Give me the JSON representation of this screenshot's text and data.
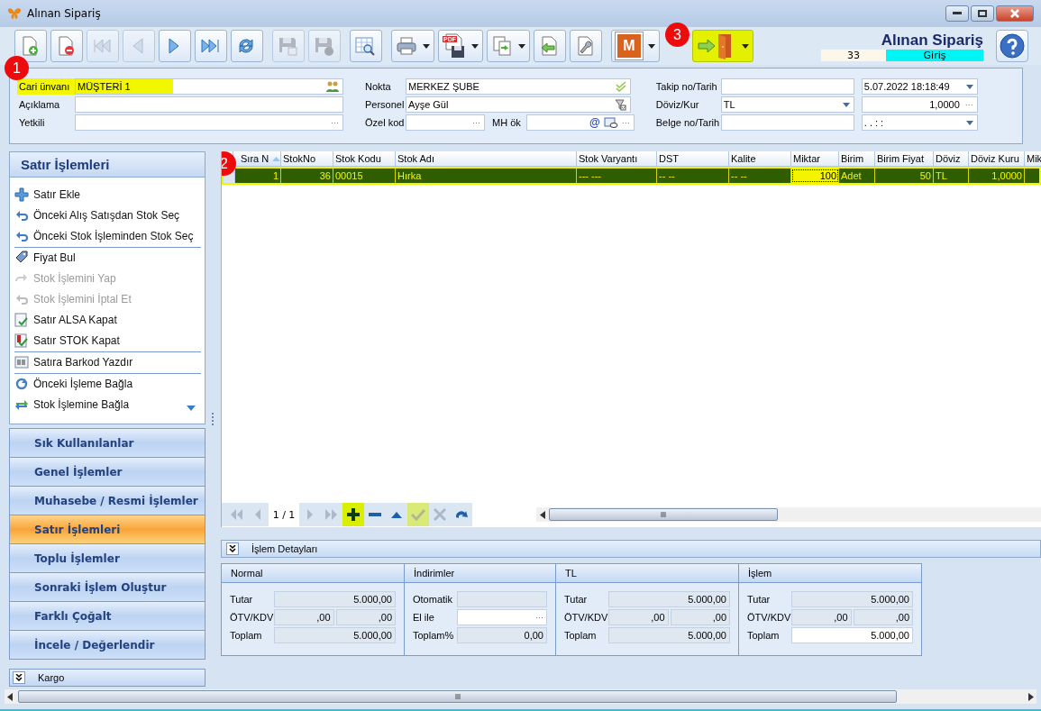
{
  "window": {
    "title": "Alınan Sipariş"
  },
  "toolbar": {
    "buttons": [
      {
        "kind": "new",
        "disabled": false,
        "dropdown": false,
        "highlighted": false
      },
      {
        "kind": "delete",
        "disabled": false,
        "dropdown": false,
        "highlighted": false
      },
      {
        "kind": "first",
        "disabled": true,
        "dropdown": false,
        "highlighted": false
      },
      {
        "kind": "prev",
        "disabled": true,
        "dropdown": false,
        "highlighted": false
      },
      {
        "kind": "next",
        "disabled": false,
        "dropdown": false,
        "highlighted": false
      },
      {
        "kind": "last",
        "disabled": false,
        "dropdown": false,
        "highlighted": false
      },
      {
        "kind": "refresh",
        "disabled": false,
        "dropdown": false,
        "highlighted": false
      },
      {
        "kind": "save",
        "disabled": true,
        "dropdown": false,
        "highlighted": false
      },
      {
        "kind": "save-close",
        "disabled": true,
        "dropdown": false,
        "highlighted": false
      },
      {
        "kind": "grid-search",
        "disabled": false,
        "dropdown": false,
        "highlighted": false
      },
      {
        "kind": "print",
        "disabled": false,
        "dropdown": true,
        "highlighted": false
      },
      {
        "kind": "pdf",
        "disabled": false,
        "dropdown": true,
        "highlighted": false,
        "label": "PDF"
      },
      {
        "kind": "copy",
        "disabled": false,
        "dropdown": true,
        "highlighted": false
      },
      {
        "kind": "import",
        "disabled": false,
        "dropdown": false,
        "highlighted": false
      },
      {
        "kind": "tools",
        "disabled": false,
        "dropdown": false,
        "highlighted": false
      },
      {
        "kind": "m",
        "disabled": false,
        "dropdown": true,
        "highlighted": false,
        "label": "M"
      },
      {
        "kind": "exit",
        "disabled": false,
        "dropdown": true,
        "highlighted": true,
        "marker": "3"
      }
    ],
    "heading": "Alınan Sipariş",
    "number": "33",
    "status": "Giriş"
  },
  "form": {
    "marker": "1",
    "columns": [
      [
        {
          "label": "Cari ünvanı",
          "highlighted": true,
          "inputs": [
            {
              "kind": "textbox",
              "value": "MÜŞTERİ 1",
              "adornments": [
                {
                  "kind": "people"
                }
              ]
            }
          ]
        },
        {
          "label": "Açıklama",
          "highlighted": false,
          "inputs": [
            {
              "kind": "textbox"
            }
          ]
        },
        {
          "label": "Yetkili",
          "highlighted": false,
          "inputs": [
            {
              "kind": "textbox",
              "adornments": [
                {
                  "kind": "glyph",
                  "text": "···"
                }
              ]
            }
          ]
        }
      ],
      [
        {
          "label": "Nokta",
          "highlighted": false,
          "inputs": [
            {
              "kind": "textbox",
              "value": "MERKEZ ŞUBE",
              "adornments": [
                {
                  "kind": "check"
                }
              ]
            }
          ]
        },
        {
          "label": "Personel",
          "highlighted": false,
          "inputs": [
            {
              "kind": "textbox",
              "value": "Ayşe Gül",
              "adornments": [
                {
                  "kind": "filter"
                }
              ]
            }
          ]
        },
        {
          "label": "Özel kod",
          "highlighted": false,
          "inputs": [
            {
              "kind": "textbox",
              "adornments": [
                {
                  "kind": "glyph",
                  "text": "···"
                }
              ]
            },
            {
              "kind": "textbox",
              "label": "MH ök",
              "adornments": [
                {
                  "kind": "glyph",
                  "text": "@"
                },
                {
                  "kind": "card"
                },
                {
                  "kind": "glyph",
                  "text": "···"
                }
              ]
            }
          ]
        }
      ],
      [
        {
          "label": "Takip no/Tarih",
          "highlighted": false,
          "inputs": [
            {
              "kind": "textbox"
            },
            {
              "kind": "combo",
              "value": "5.07.2022 18:18:49"
            }
          ]
        },
        {
          "label": "Döviz/Kur",
          "highlighted": false,
          "inputs": [
            {
              "kind": "combo",
              "value": "TL"
            },
            {
              "kind": "number",
              "value": "1,0000",
              "adornments": [
                {
                  "kind": "glyph",
                  "text": "···"
                }
              ]
            }
          ]
        },
        {
          "label": "Belge no/Tarih",
          "highlighted": false,
          "inputs": [
            {
              "kind": "textbox"
            },
            {
              "kind": "combo",
              "value": ". .     : :"
            }
          ]
        }
      ]
    ]
  },
  "side_panel": {
    "title": "Satır İşlemleri",
    "items": [
      {
        "kind": "plus",
        "label": "Satır Ekle",
        "disabled": false,
        "divider_after": false
      },
      {
        "kind": "back",
        "label": "Önceki Alış Satışdan Stok Seç",
        "disabled": false,
        "divider_after": false
      },
      {
        "kind": "back",
        "label": "Önceki Stok İşleminden Stok Seç",
        "disabled": false,
        "divider_after": true
      },
      {
        "kind": "tag",
        "label": "Fiyat Bul",
        "disabled": false,
        "divider_after": false
      },
      {
        "kind": "redo",
        "label": "Stok İşlemini Yap",
        "disabled": true,
        "divider_after": false
      },
      {
        "kind": "undo",
        "label": "Stok İşlemini İptal Et",
        "disabled": true,
        "divider_after": false
      },
      {
        "kind": "doc-check",
        "label": "Satır ALSA Kapat",
        "disabled": false,
        "divider_after": false
      },
      {
        "kind": "doc-flag-check",
        "label": "Satır STOK Kapat",
        "disabled": false,
        "divider_after": true
      },
      {
        "kind": "barcode",
        "label": "Satıra Barkod Yazdır",
        "disabled": false,
        "divider_after": true
      },
      {
        "kind": "cycle",
        "label": "Önceki İşleme Bağla",
        "disabled": false,
        "divider_after": false
      },
      {
        "kind": "swap",
        "label": "Stok İşlemine Bağla",
        "disabled": false,
        "divider_after": false
      }
    ],
    "groups": [
      {
        "label": "Sık Kullanılanlar",
        "selected": false
      },
      {
        "label": "Genel İşlemler",
        "selected": false
      },
      {
        "label": "Muhasebe / Resmi İşlemler",
        "selected": false
      },
      {
        "label": "Satır İşlemleri",
        "selected": true
      },
      {
        "label": "Toplu İşlemler",
        "selected": false
      },
      {
        "label": "Sonraki İşlem Oluştur",
        "selected": false
      },
      {
        "label": "Farklı Çoğalt",
        "selected": false
      },
      {
        "label": "İncele / Değerlendir",
        "selected": false
      }
    ],
    "footer": "Kargo"
  },
  "grid": {
    "marker": "2",
    "columns": [
      {
        "label": "Sıra N",
        "kind": "number",
        "sorted": true
      },
      {
        "label": "StokNo",
        "kind": "number",
        "sorted": false
      },
      {
        "label": "Stok Kodu",
        "kind": "text",
        "sorted": false
      },
      {
        "label": "Stok Adı",
        "kind": "text",
        "sorted": false
      },
      {
        "label": "Stok Varyantı",
        "kind": "text",
        "sorted": false
      },
      {
        "label": "DST",
        "kind": "text",
        "sorted": false
      },
      {
        "label": "Kalite",
        "kind": "text",
        "sorted": false
      },
      {
        "label": "Miktar",
        "kind": "number",
        "sorted": false
      },
      {
        "label": "Birim",
        "kind": "text",
        "sorted": false
      },
      {
        "label": "Birim Fiyat",
        "kind": "number",
        "sorted": false
      },
      {
        "label": "Döviz",
        "kind": "text",
        "sorted": false
      },
      {
        "label": "Döviz Kuru",
        "kind": "number",
        "sorted": false
      },
      {
        "label": "Mik",
        "kind": "text",
        "sorted": false
      }
    ],
    "rows": [
      {
        "selected": true,
        "cells": [
          {
            "text": "1",
            "focused": false
          },
          {
            "text": "36",
            "focused": false
          },
          {
            "text": "00015",
            "focused": false
          },
          {
            "text": "Hırka",
            "focused": false
          },
          {
            "text": "--- ---",
            "focused": false
          },
          {
            "text": "-- --",
            "focused": false
          },
          {
            "text": "-- --",
            "focused": false
          },
          {
            "text": "100",
            "focused": true
          },
          {
            "text": "Adet",
            "focused": false
          },
          {
            "text": "50",
            "focused": false
          },
          {
            "text": "TL",
            "focused": false
          },
          {
            "text": "1,0000",
            "focused": false
          }
        ]
      }
    ],
    "navigator": {
      "page": "1 / 1",
      "buttons": [
        {
          "kind": "first",
          "disabled": true,
          "highlighted": false
        },
        {
          "kind": "prev",
          "disabled": true,
          "highlighted": false
        },
        {
          "kind": "page"
        },
        {
          "kind": "next",
          "disabled": true,
          "highlighted": false
        },
        {
          "kind": "last",
          "disabled": true,
          "highlighted": false
        },
        {
          "kind": "add",
          "disabled": false,
          "highlighted": true
        },
        {
          "kind": "remove",
          "disabled": false,
          "highlighted": false
        },
        {
          "kind": "up",
          "disabled": false,
          "highlighted": false
        },
        {
          "kind": "apply",
          "disabled": true,
          "highlighted": true
        },
        {
          "kind": "cancel",
          "disabled": true,
          "highlighted": false
        },
        {
          "kind": "redo",
          "disabled": false,
          "highlighted": false
        }
      ]
    }
  },
  "details": {
    "title": "İşlem Detayları",
    "panels": [
      {
        "title": "Normal",
        "rows": [
          {
            "label": "Tutar",
            "fields": [
              {
                "value": "5.000,00",
                "editable": false
              }
            ]
          },
          {
            "label": "ÖTV/KDV",
            "fields": [
              {
                "value": ",00",
                "editable": false
              },
              {
                "value": ",00",
                "editable": false
              }
            ]
          },
          {
            "label": "Toplam",
            "fields": [
              {
                "value": "5.000,00",
                "editable": false
              }
            ]
          }
        ]
      },
      {
        "title": "İndirimler",
        "rows": [
          {
            "label": "Otomatik",
            "fields": [
              {
                "editable": false
              }
            ]
          },
          {
            "label": "El ile",
            "fields": [
              {
                "editable": true,
                "adornment": "···"
              }
            ]
          },
          {
            "label": "Toplam%",
            "fields": [
              {
                "value": "0,00",
                "editable": false
              }
            ]
          }
        ]
      },
      {
        "title": "TL",
        "rows": [
          {
            "label": "Tutar",
            "fields": [
              {
                "value": "5.000,00",
                "editable": false
              }
            ]
          },
          {
            "label": "ÖTV/KDV",
            "fields": [
              {
                "value": ",00",
                "editable": false
              },
              {
                "value": ",00",
                "editable": false
              }
            ]
          },
          {
            "label": "Toplam",
            "fields": [
              {
                "value": "5.000,00",
                "editable": false
              }
            ]
          }
        ]
      },
      {
        "title": "İşlem",
        "rows": [
          {
            "label": "Tutar",
            "fields": [
              {
                "value": "5.000,00",
                "editable": false
              }
            ]
          },
          {
            "label": "ÖTV/KDV",
            "fields": [
              {
                "value": ",00",
                "editable": false
              },
              {
                "value": ",00",
                "editable": false
              }
            ]
          },
          {
            "label": "Toplam",
            "fields": [
              {
                "value": "5.000,00",
                "editable": true
              }
            ]
          }
        ]
      }
    ]
  }
}
